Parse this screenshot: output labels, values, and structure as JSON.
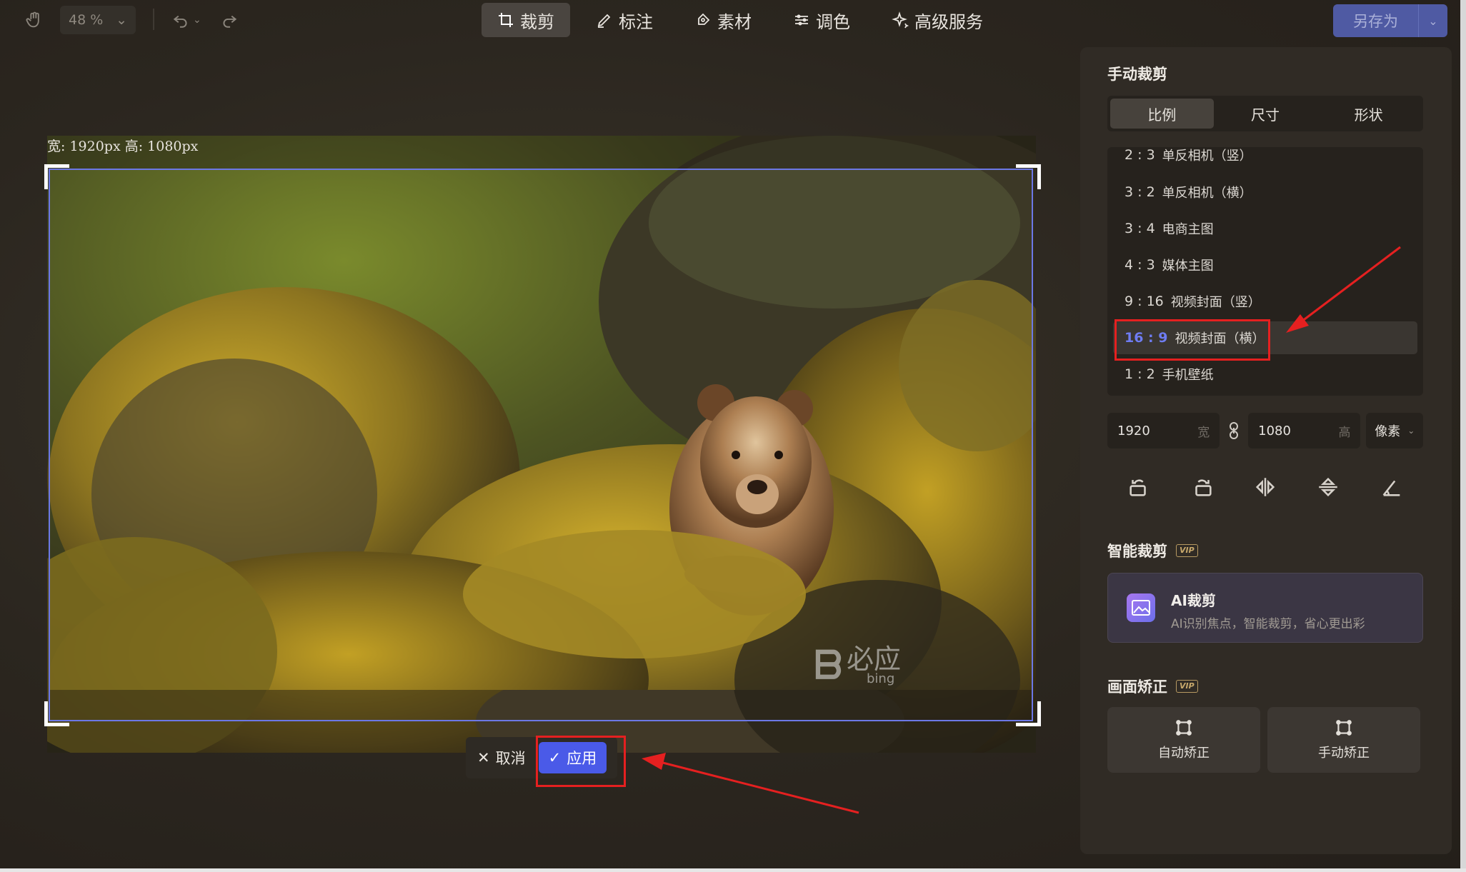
{
  "toolbar": {
    "zoom": "48 %",
    "tabs": [
      {
        "label": "裁剪",
        "icon": "crop-icon"
      },
      {
        "label": "标注",
        "icon": "pen-icon"
      },
      {
        "label": "素材",
        "icon": "sticker-icon"
      },
      {
        "label": "调色",
        "icon": "adjust-icon"
      },
      {
        "label": "高级服务",
        "icon": "sparkle-icon"
      }
    ],
    "save_label": "另存为"
  },
  "canvas": {
    "dimensions_label": "宽: 1920px   高: 1080px",
    "watermark_cn": "必应",
    "watermark_en": "bing"
  },
  "crop_actions": {
    "cancel": "取消",
    "apply": "应用"
  },
  "panel": {
    "manual_crop": {
      "title": "手动裁剪",
      "segments": [
        "比例",
        "尺寸",
        "形状"
      ],
      "ratios": [
        {
          "ratio": "2 : 3",
          "label": "单反相机（竖）"
        },
        {
          "ratio": "3 : 2",
          "label": "单反相机（横）"
        },
        {
          "ratio": "3 : 4",
          "label": "电商主图"
        },
        {
          "ratio": "4 : 3",
          "label": "媒体主图"
        },
        {
          "ratio": "9 : 16",
          "label": "视频封面（竖）"
        },
        {
          "ratio": "16 : 9",
          "label": "视频封面（横）"
        },
        {
          "ratio": "1 : 2",
          "label": "手机壁纸"
        }
      ],
      "width_value": "1920",
      "width_unit": "宽",
      "height_value": "1080",
      "height_unit": "高",
      "unit_select": "像素"
    },
    "smart_crop": {
      "title": "智能裁剪",
      "vip": "VIP",
      "card_title": "AI裁剪",
      "card_desc": "AI识别焦点，智能裁剪，省心更出彩"
    },
    "correction": {
      "title": "画面矫正",
      "vip": "VIP",
      "auto_label": "自动矫正",
      "manual_label": "手动矫正"
    }
  },
  "colors": {
    "accent": "#4a5ae8",
    "selected_ratio": "#6e7cf2",
    "annotation_red": "#e52020"
  }
}
